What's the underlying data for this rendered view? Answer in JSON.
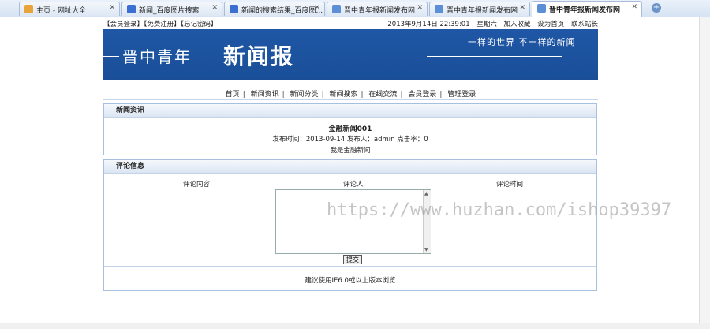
{
  "tabs": [
    {
      "label": "主页 - 网址大全",
      "icon": "home-icon",
      "color": "#e8a43a"
    },
    {
      "label": "新闻_百度图片搜索",
      "icon": "paw-icon",
      "color": "#3b6fd1"
    },
    {
      "label": "新闻的搜索结果_百度图...",
      "icon": "paw-icon",
      "color": "#3b6fd1"
    },
    {
      "label": "晋中青年报新闻发布网",
      "icon": "page-icon",
      "color": "#5c8fd6"
    },
    {
      "label": "晋中青年报新闻发布网",
      "icon": "page-icon",
      "color": "#5c8fd6"
    },
    {
      "label": "晋中青年报新闻发布网",
      "icon": "page-icon",
      "color": "#5c8fd6"
    }
  ],
  "topbar": {
    "links": "【会员登录】【免费注册】【忘记密码】",
    "date": "2013年9月14日 22:39:01",
    "weekday": "星期六",
    "favorite": "加入收藏",
    "homepage": "设为首页",
    "contact": "联系站长"
  },
  "banner": {
    "title_small": "晋中青年",
    "title_big": "新闻报",
    "slogan": "一样的世界 不一样的新闻"
  },
  "nav": [
    "首页",
    "新闻资讯",
    "新闻分类",
    "新闻搜索",
    "在线交流",
    "会员登录",
    "管理登录"
  ],
  "news": {
    "section_title": "新闻资讯",
    "title": "金融新闻001",
    "meta": "发布时间：2013-09-14 发布人：admin 点击率：0",
    "body": "我是金融新闻"
  },
  "comments": {
    "section_title": "评论信息",
    "col_content": "评论内容",
    "col_author": "评论人",
    "col_time": "评论时间",
    "textarea_value": "",
    "submit_label": "提交",
    "tip": "建议使用IE6.0或以上版本浏览"
  },
  "watermark": "https://www.huzhan.com/ishop39397"
}
